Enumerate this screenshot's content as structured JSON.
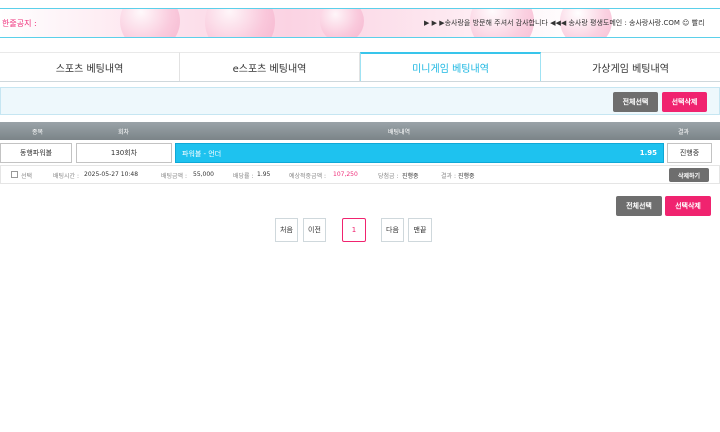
{
  "notice": {
    "label": "한줄공지 :",
    "text": "▶ ▶ ▶송사랑을 방문해 주셔서 감사합니다 ◀◀◀ 송사랑 평생도메인 : 송사랑사랑.COM ☺ 빨리"
  },
  "tabs": [
    {
      "label": "스포츠 베팅내역",
      "active": false
    },
    {
      "label": "e스포츠 베팅내역",
      "active": false
    },
    {
      "label": "미니게임 베팅내역",
      "active": true
    },
    {
      "label": "가상게임 베팅내역",
      "active": false
    }
  ],
  "actions": {
    "select_all": "전체선택",
    "delete_selected": "선택삭제"
  },
  "table": {
    "headers": {
      "game": "종목",
      "round": "회차",
      "bet": "배팅내역",
      "result": "결과"
    },
    "row": {
      "game": "동행파워볼",
      "round": "130회차",
      "pick": "파워볼 - 언더",
      "odds": "1.95",
      "status": "진행중"
    },
    "info": {
      "select": "선택",
      "bet_time_label": "배팅시간 :",
      "bet_time": "2025-05-27 10:48",
      "bet_amount_label": "배팅금액 :",
      "bet_amount": "55,000",
      "odds_label": "배당률 :",
      "odds": "1.95",
      "expected_label": "예상적중금액 :",
      "expected": "107,250",
      "win_label": "당첨금 :",
      "win": "진행중",
      "result_label": "결과 :",
      "result": "진행중",
      "delete": "삭제하기"
    }
  },
  "pagination": {
    "first": "처음",
    "prev": "이전",
    "current": "1",
    "next": "다음",
    "last": "맨끝"
  },
  "colors": {
    "accent_blue": "#1ec2ef",
    "accent_pink": "#f0236f",
    "header_gray": "#7b8488"
  }
}
